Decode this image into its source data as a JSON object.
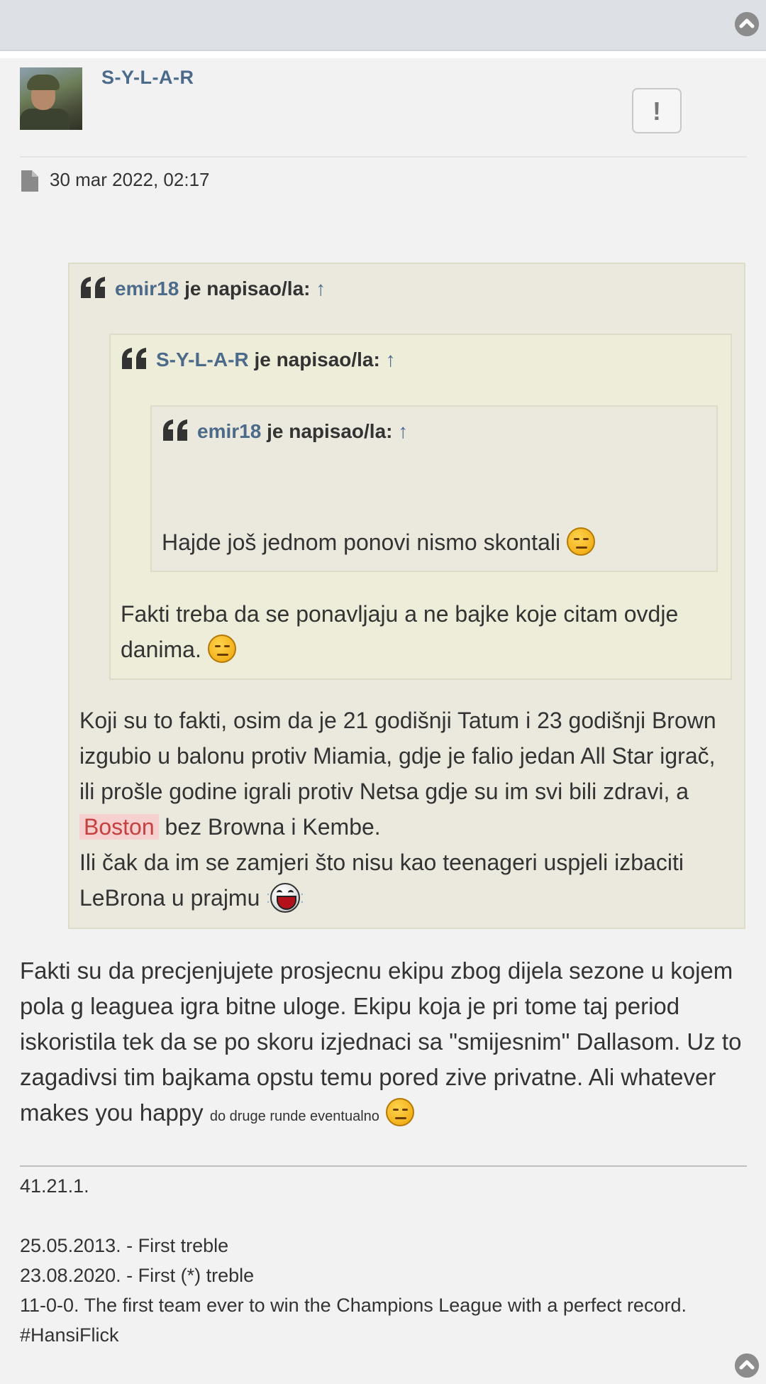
{
  "post": {
    "author": "S-Y-L-A-R",
    "report_label": "!",
    "date": "30 mar 2022, 02:17"
  },
  "quotes": {
    "outer": {
      "author": "emir18",
      "wrote": "je napisao/la:",
      "arrow": "↑",
      "text_1": "Koji su to fakti, osim da je 21 godišnji Tatum i 23 godišnji Brown izgubio u balonu protiv Miamia, gdje je falio jedan All Star igrač, ili prošle godine igrali protiv Netsa gdje su im svi bili zdravi, a",
      "highlight": "Boston",
      "text_2": "bez Browna i Kembe.",
      "text_3": "Ili čak da im se zamjeri što nisu kao teenageri uspjeli izbaciti LeBrona u prajmu"
    },
    "middle": {
      "author": "S-Y-L-A-R",
      "wrote": "je napisao/la:",
      "arrow": "↑",
      "text": "Fakti treba da se ponavljaju a ne bajke koje citam ovdje danima."
    },
    "inner": {
      "author": "emir18",
      "wrote": "je napisao/la:",
      "arrow": "↑",
      "text": "Hajde još jednom ponovi nismo skontali"
    }
  },
  "body": {
    "text": "Fakti su da precjenjujete prosjecnu ekipu zbog dijela sezone u kojem pola g leaguea igra bitne uloge. Ekipu koja je pri tome taj period iskoristila tek da se po skoru izjednaci sa \"smijesnim\" Dallasom. Uz to zagadivsi tim bajkama opstu temu pored zive privatne. Ali whatever makes you happy",
    "small": "do druge runde eventualno"
  },
  "signature": {
    "line1": "41.21.1.",
    "line2": "25.05.2013. - First treble",
    "line3": "23.08.2020. - First (*) treble",
    "line4": "11-0-0. The first team ever to win the Champions League with a perfect record. #HansiFlick"
  },
  "icons": {
    "scroll_top": "chevron-up-circle-icon",
    "file": "file-icon",
    "quote": "quote-icon",
    "emoji_annoyed": "annoyed-face-icon",
    "emoji_laugh": "laughing-face-icon"
  },
  "colors": {
    "link": "#4c6a8a",
    "highlight_bg": "#f6cfcf",
    "highlight_text": "#c3413f",
    "quote_bg": "#ebe9dd"
  }
}
